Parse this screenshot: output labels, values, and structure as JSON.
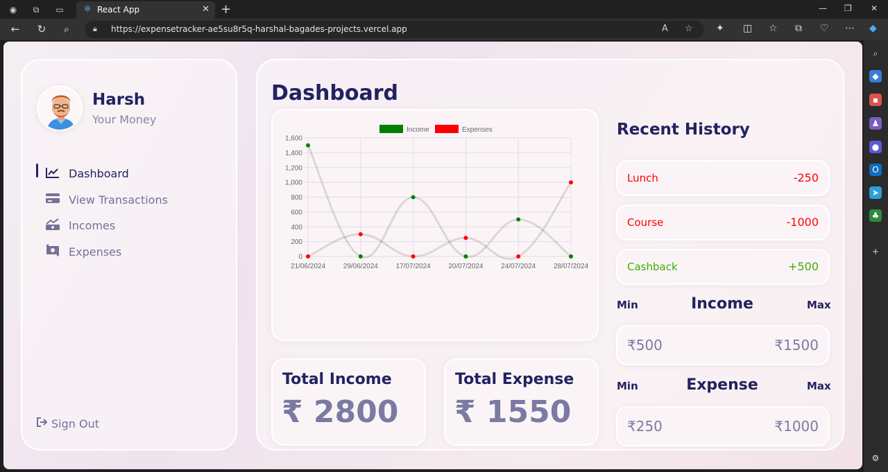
{
  "browser": {
    "tab_title": "React App",
    "url": "https://expensetracker-ae5su8r5q-harshal-bagades-projects.vercel.app"
  },
  "user": {
    "name": "Harsh",
    "subtitle": "Your Money"
  },
  "menu": [
    {
      "label": "Dashboard",
      "icon": "chart-line-icon",
      "active": true
    },
    {
      "label": "View Transactions",
      "icon": "credit-card-icon",
      "active": false
    },
    {
      "label": "Incomes",
      "icon": "money-bill-trend-icon",
      "active": false
    },
    {
      "label": "Expenses",
      "icon": "money-bill-transfer-icon",
      "active": false
    }
  ],
  "signout": {
    "label": "Sign Out"
  },
  "dashboard": {
    "title": "Dashboard"
  },
  "chart_data": {
    "type": "line",
    "categories": [
      "21/06/2024",
      "29/06/2024",
      "17/07/2024",
      "20/07/2024",
      "24/07/2024",
      "28/07/2024"
    ],
    "series": [
      {
        "name": "Income",
        "color": "#008000",
        "values": [
          1500,
          0,
          800,
          0,
          500,
          0
        ]
      },
      {
        "name": "Expenses",
        "color": "#ff0000",
        "values": [
          0,
          300,
          0,
          250,
          0,
          1000
        ]
      }
    ],
    "ylim": [
      0,
      1600
    ],
    "yticks": [
      "0",
      "200",
      "400",
      "600",
      "800",
      "1,000",
      "1,200",
      "1,400",
      "1,600"
    ],
    "legend": "top-center",
    "grid": true
  },
  "totals": {
    "income_label": "Total Income",
    "income_value": "₹ 2800",
    "expense_label": "Total Expense",
    "expense_value": "₹ 1550"
  },
  "history": {
    "title": "Recent History",
    "items": [
      {
        "name": "Lunch",
        "amount": "-250",
        "color": "#ff0000"
      },
      {
        "name": "Course",
        "amount": "-1000",
        "color": "#ff0000"
      },
      {
        "name": "Cashback",
        "amount": "+500",
        "color": "#3bb000"
      }
    ]
  },
  "income_range": {
    "title": "Income",
    "min_label": "Min",
    "max_label": "Max",
    "min": "₹500",
    "max": "₹1500"
  },
  "expense_range": {
    "title": "Expense",
    "min_label": "Min",
    "max_label": "Max",
    "min": "₹250",
    "max": "₹1000"
  }
}
